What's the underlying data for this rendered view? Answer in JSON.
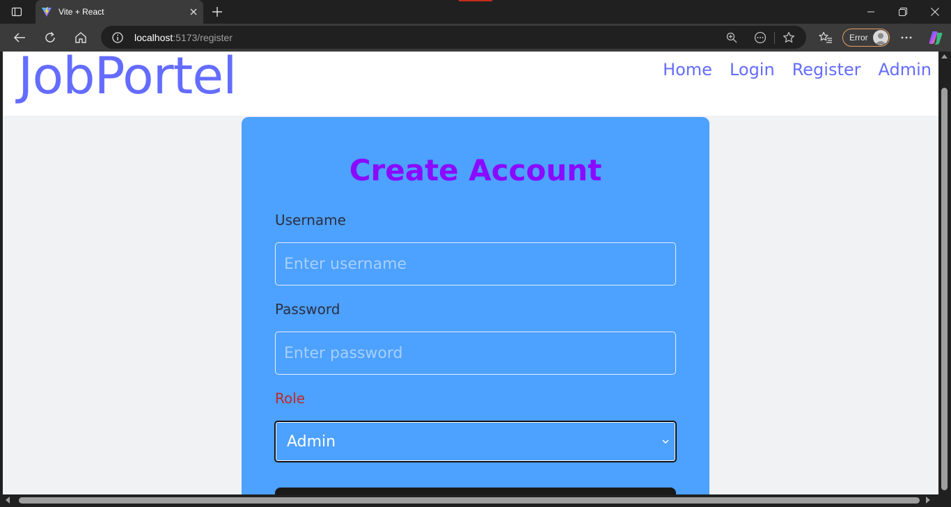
{
  "browser": {
    "tab_title": "Vite + React",
    "url_host": "localhost",
    "url_path": ":5173/register",
    "profile_status": "Error",
    "icons": {
      "tab_actions": "tab-actions-icon",
      "favicon": "vite-logo-icon",
      "close_tab": "close-icon",
      "new_tab": "plus-icon",
      "minimize": "minimize-icon",
      "maximize": "restore-icon",
      "close_window": "close-icon",
      "back": "back-arrow-icon",
      "refresh": "refresh-icon",
      "home": "home-icon",
      "site_info": "info-icon",
      "zoom": "zoom-icon",
      "reader": "more-circle-icon",
      "favorite": "star-icon",
      "favorites_hub": "favorites-icon",
      "settings_more": "ellipsis-icon",
      "copilot": "copilot-icon"
    }
  },
  "site": {
    "brand": "JobPortel",
    "nav": [
      "Home",
      "Login",
      "Register",
      "Admin"
    ]
  },
  "form": {
    "title": "Create Account",
    "username_label": "Username",
    "username_placeholder": "Enter username",
    "password_label": "Password",
    "password_placeholder": "Enter password",
    "role_label": "Role",
    "role_value": "Admin"
  },
  "colors": {
    "brand": "#646cff",
    "card": "#4da1ff",
    "title": "#8a0aff",
    "role_label": "#c0282a",
    "page_bg": "#f1f2f4"
  }
}
